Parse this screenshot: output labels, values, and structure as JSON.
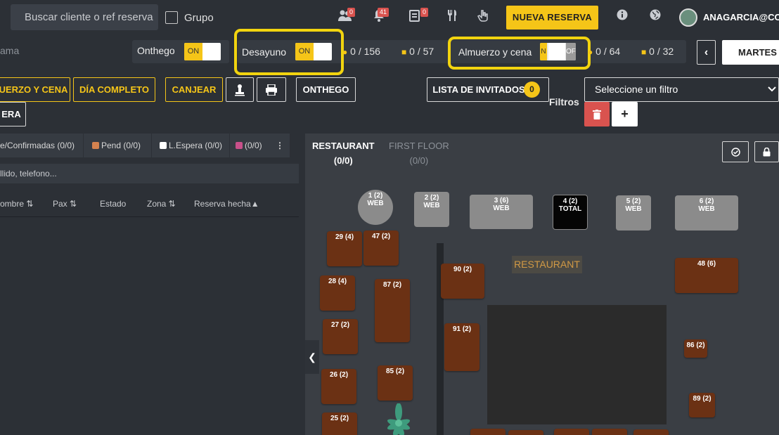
{
  "topbar": {
    "search_placeholder": "Buscar cliente o ref reserva",
    "group_label": "Grupo",
    "badges": [
      "0",
      "41",
      "0"
    ],
    "icons": [
      "users-icon",
      "bell-icon",
      "notes-icon",
      "cutlery-icon",
      "hand-icon"
    ],
    "new_reservation": "NUEVA RESERVA",
    "user": "ANAGARCIA@COV"
  },
  "services": {
    "left_cut": "ama",
    "onthego_label": "Onthego",
    "onthego_toggle": "ON",
    "desayuno_label": "Desayuno",
    "desayuno_toggle": "ON",
    "desayuno_pax": "0 / 156",
    "desayuno_tables": "0 / 57",
    "almuerzo_label": "Almuerzo y cena",
    "almuerzo_toggle_on": "N",
    "almuerzo_toggle_off": "OF",
    "almuerzo_pax": "0 / 64",
    "almuerzo_tables": "0 / 32",
    "prev": "‹",
    "date": "MARTES T"
  },
  "actions": {
    "almuerzo_cena": "UERZO Y CENA",
    "dia_completo": "DÍA COMPLETO",
    "canjear": "CANJEAR",
    "onthego": "ONTHEGO",
    "lista_invitados": "LISTA DE INVITADOS",
    "lista_count": "0",
    "espera": "ERA",
    "filter_placeholder": "Seleccione un filtro",
    "filtros_label": "Filtros",
    "delete_glyph": "🗑",
    "add_glyph": "+"
  },
  "left": {
    "tabs": [
      "e/Confirmadas (0/0)",
      "Pend (0/0)",
      "L.Espera (0/0)",
      "(0/0)"
    ],
    "tab_colors": [
      "#d4824f",
      "#ffffff",
      "#c8508a"
    ],
    "more": "⋮",
    "filter_text": "llido, telefono...",
    "columns": [
      "ombre ⇅",
      "Pax ⇅",
      "Estado",
      "Zona ⇅",
      "Reserva hecha▲"
    ]
  },
  "map": {
    "tabs": [
      {
        "name": "RESTAURANT",
        "count": "(0/0)"
      },
      {
        "name": "FIRST FLOOR",
        "count": "(0/0)"
      }
    ],
    "area_label": "RESTAURANT",
    "collapse": "❮",
    "tables": [
      {
        "id": "1 (2)",
        "sub": "WEB"
      },
      {
        "id": "2 (2)",
        "sub": "WEB"
      },
      {
        "id": "3 (6)",
        "sub": "WEB"
      },
      {
        "id": "4 (2)",
        "sub": "TOTAL"
      },
      {
        "id": "5 (2)",
        "sub": "WEB"
      },
      {
        "id": "6 (2)",
        "sub": "WEB"
      },
      {
        "id": "29 (4)"
      },
      {
        "id": "47 (2)"
      },
      {
        "id": "28 (4)"
      },
      {
        "id": "87 (2)"
      },
      {
        "id": "90 (2)"
      },
      {
        "id": "48 (6)"
      },
      {
        "id": "27 (2)"
      },
      {
        "id": "91 (2)"
      },
      {
        "id": "86 (2)"
      },
      {
        "id": "26 (2)"
      },
      {
        "id": "85 (2)"
      },
      {
        "id": "89 (2)"
      },
      {
        "id": "25 (2)"
      }
    ]
  }
}
